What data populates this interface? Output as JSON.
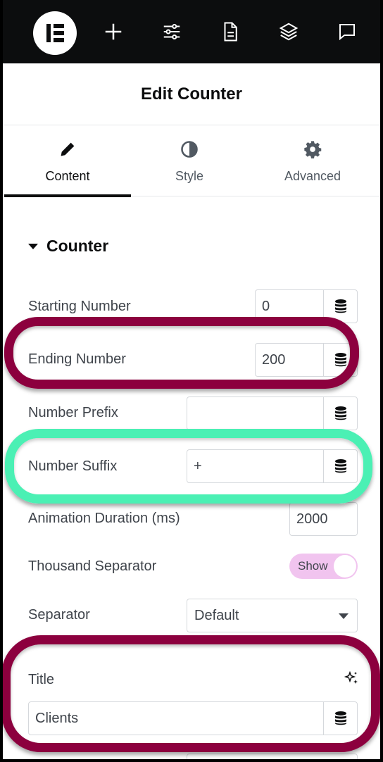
{
  "header": {
    "title": "Edit Counter"
  },
  "toolbar": {
    "icons": [
      "elementor-logo-icon",
      "add-icon",
      "settings-sliders-icon",
      "page-icon",
      "layers-icon",
      "comment-icon"
    ]
  },
  "tabs": [
    {
      "label": "Content",
      "icon": "pencil-icon",
      "active": true
    },
    {
      "label": "Style",
      "icon": "half-circle-icon",
      "active": false
    },
    {
      "label": "Advanced",
      "icon": "gear-icon",
      "active": false
    }
  ],
  "section": {
    "title": "Counter"
  },
  "fields": {
    "starting_number": {
      "label": "Starting Number",
      "value": "0"
    },
    "ending_number": {
      "label": "Ending Number",
      "value": "200"
    },
    "number_prefix": {
      "label": "Number Prefix",
      "value": ""
    },
    "number_suffix": {
      "label": "Number Suffix",
      "value": "+"
    },
    "animation_duration": {
      "label": "Animation Duration (ms)",
      "value": "2000"
    },
    "thousand_separator": {
      "label": "Thousand Separator",
      "toggle_label": "Show",
      "on": true
    },
    "separator": {
      "label": "Separator",
      "value": "Default"
    },
    "title": {
      "label": "Title",
      "value": "Clients"
    }
  },
  "colors": {
    "highlight_maroon": "#8c003e",
    "highlight_teal": "#4bf0b4",
    "toggle_on": "#f1c4ef",
    "toolbar_bg": "#0c0d0e"
  }
}
